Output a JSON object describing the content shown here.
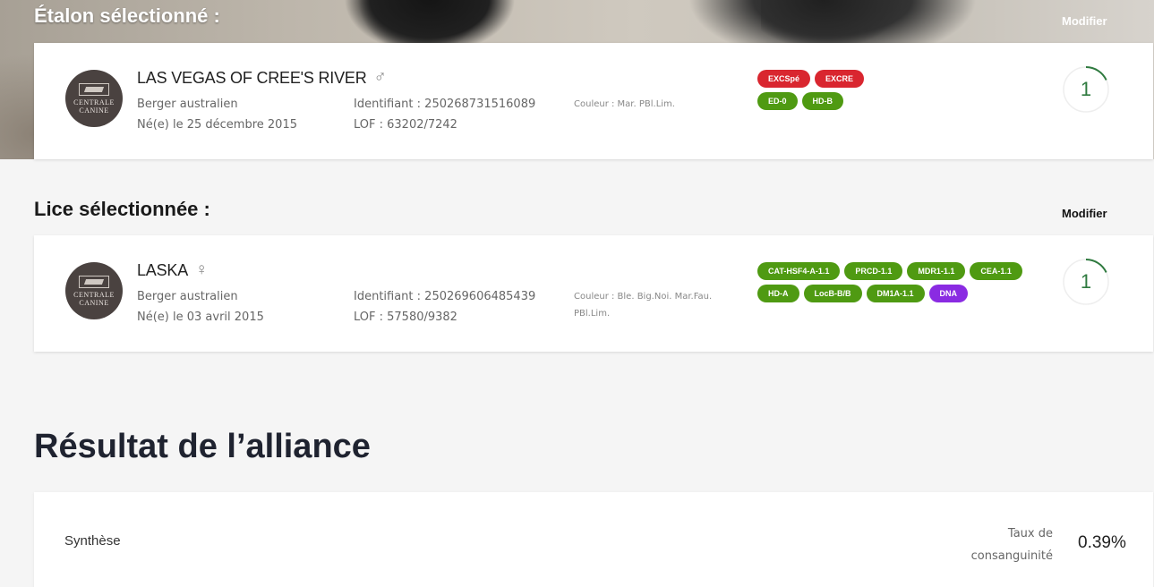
{
  "stallion": {
    "section_title": "Étalon sélectionné :",
    "modify_label": "Modifier",
    "logo_text": [
      "CENTRALE",
      "CANINE"
    ],
    "name": "LAS VEGAS OF CREE'S RIVER",
    "sex_symbol": "♂",
    "breed": "Berger australien",
    "birth": "Né(e) le 25 décembre 2015",
    "identifier": "Identifiant : 250268731516089",
    "lof": "LOF : 63202/7242",
    "color": "Couleur : Mar. PBl.Lim.",
    "badges": [
      {
        "label": "EXCSpé",
        "color": "#d9262f"
      },
      {
        "label": "EXCRE",
        "color": "#d9262f"
      },
      {
        "label": "ED-0",
        "color": "#4f9a12"
      },
      {
        "label": "HD-B",
        "color": "#4f9a12"
      }
    ],
    "score": "1"
  },
  "dam": {
    "section_title": "Lice sélectionnée :",
    "modify_label": "Modifier",
    "logo_text": [
      "CENTRALE",
      "CANINE"
    ],
    "name": "LASKA",
    "sex_symbol": "♀",
    "breed": "Berger australien",
    "birth": "Né(e) le 03 avril 2015",
    "identifier": "Identifiant : 250269606485439",
    "lof": "LOF : 57580/9382",
    "color_line1": "Couleur : Ble. Big.Noi. Mar.Fau.",
    "color_line2": "PBl.Lim.",
    "badges": [
      {
        "label": "CAT-HSF4-A-1.1",
        "color": "#4f9a12"
      },
      {
        "label": "PRCD-1.1",
        "color": "#4f9a12"
      },
      {
        "label": "MDR1-1.1",
        "color": "#4f9a12"
      },
      {
        "label": "CEA-1.1",
        "color": "#4f9a12"
      },
      {
        "label": "HD-A",
        "color": "#4f9a12"
      },
      {
        "label": "LocB-B/B",
        "color": "#4f9a12"
      },
      {
        "label": "DM1A-1.1",
        "color": "#4f9a12"
      },
      {
        "label": "DNA",
        "color": "#8a2be2"
      }
    ],
    "score": "1"
  },
  "result": {
    "title": "Résultat de l’alliance",
    "synthesis_label": "Synthèse",
    "rate_label_line1": "Taux de",
    "rate_label_line2": "consanguinité",
    "rate_value": "0.39%"
  },
  "score_ring": {
    "track_color": "#eeeeee",
    "arc_color": "#2f7a3f",
    "fraction": 0.18
  }
}
